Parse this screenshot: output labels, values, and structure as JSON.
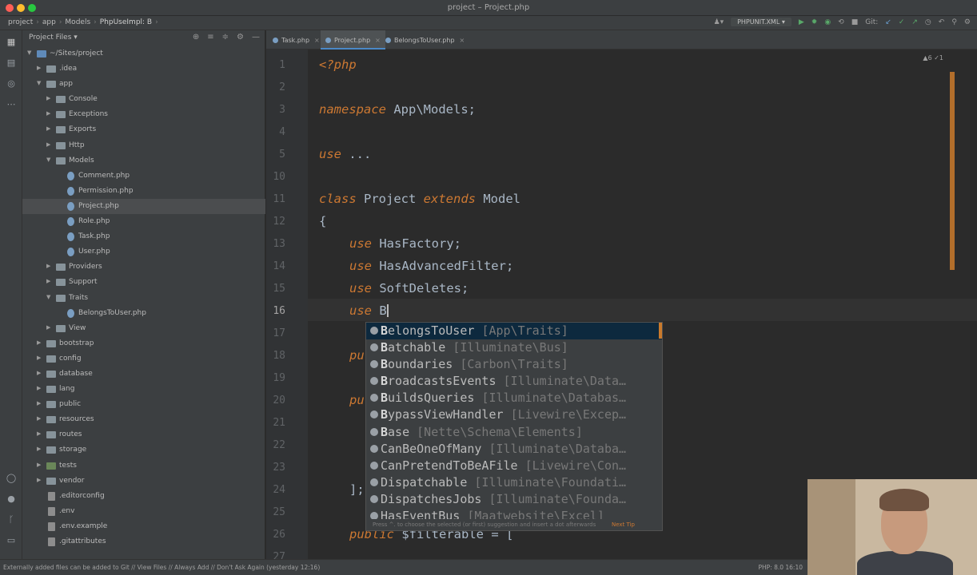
{
  "window": {
    "title": "project – Project.php"
  },
  "breadcrumb": [
    "project",
    "app",
    "Models",
    "PhpUseImpl: B"
  ],
  "toolbar": {
    "run_config": "PHPUNIT.XML",
    "git_label": "Git:"
  },
  "project_panel": {
    "title": "Project Files",
    "tree": [
      {
        "label": "~/Sites/project",
        "level": 0,
        "type": "folder",
        "open": true
      },
      {
        "label": ".idea",
        "level": 1,
        "type": "folder"
      },
      {
        "label": "app",
        "level": 1,
        "type": "folder",
        "open": true
      },
      {
        "label": "Console",
        "level": 2,
        "type": "folder"
      },
      {
        "label": "Exceptions",
        "level": 2,
        "type": "folder"
      },
      {
        "label": "Exports",
        "level": 2,
        "type": "folder"
      },
      {
        "label": "Http",
        "level": 2,
        "type": "folder"
      },
      {
        "label": "Models",
        "level": 2,
        "type": "folder",
        "open": true
      },
      {
        "label": "Comment.php",
        "level": 3,
        "type": "php"
      },
      {
        "label": "Permission.php",
        "level": 3,
        "type": "php"
      },
      {
        "label": "Project.php",
        "level": 3,
        "type": "php",
        "selected": true
      },
      {
        "label": "Role.php",
        "level": 3,
        "type": "php"
      },
      {
        "label": "Task.php",
        "level": 3,
        "type": "php"
      },
      {
        "label": "User.php",
        "level": 3,
        "type": "php"
      },
      {
        "label": "Providers",
        "level": 2,
        "type": "folder"
      },
      {
        "label": "Support",
        "level": 2,
        "type": "folder"
      },
      {
        "label": "Traits",
        "level": 2,
        "type": "folder",
        "open": true
      },
      {
        "label": "BelongsToUser.php",
        "level": 3,
        "type": "php"
      },
      {
        "label": "View",
        "level": 2,
        "type": "folder"
      },
      {
        "label": "bootstrap",
        "level": 1,
        "type": "folder"
      },
      {
        "label": "config",
        "level": 1,
        "type": "folder"
      },
      {
        "label": "database",
        "level": 1,
        "type": "folder"
      },
      {
        "label": "lang",
        "level": 1,
        "type": "folder"
      },
      {
        "label": "public",
        "level": 1,
        "type": "folder"
      },
      {
        "label": "resources",
        "level": 1,
        "type": "folder"
      },
      {
        "label": "routes",
        "level": 1,
        "type": "folder"
      },
      {
        "label": "storage",
        "level": 1,
        "type": "folder"
      },
      {
        "label": "tests",
        "level": 1,
        "type": "folder",
        "green": true
      },
      {
        "label": "vendor",
        "level": 1,
        "type": "folder"
      },
      {
        "label": ".editorconfig",
        "level": 1,
        "type": "file"
      },
      {
        "label": ".env",
        "level": 1,
        "type": "file"
      },
      {
        "label": ".env.example",
        "level": 1,
        "type": "file"
      },
      {
        "label": ".gitattributes",
        "level": 1,
        "type": "file"
      }
    ]
  },
  "tabs": [
    {
      "label": "Task.php",
      "active": false
    },
    {
      "label": "Project.php",
      "active": true
    },
    {
      "label": "BelongsToUser.php",
      "active": false
    }
  ],
  "editor": {
    "inspection": "▲6 ✓1",
    "line_numbers": [
      "1",
      "2",
      "3",
      "4",
      "5",
      "10",
      "11",
      "12",
      "13",
      "14",
      "15",
      "16",
      "17",
      "18",
      "19",
      "20",
      "21",
      "22",
      "23",
      "24",
      "25",
      "26",
      "27"
    ],
    "current_line": "16",
    "code": {
      "l1": "<?php",
      "l3_kw": "namespace",
      "l3_rest": " App\\Models;",
      "l5_kw": "use",
      "l5_rest": " ...",
      "l11_kw1": "class",
      "l11_mid": " Project ",
      "l11_kw2": "extends",
      "l11_rest": " Model",
      "l12": "{",
      "l13_kw": "use",
      "l13_rest": " HasFactory;",
      "l14_kw": "use",
      "l14_rest": " HasAdvancedFilter;",
      "l15_kw": "use",
      "l15_rest": " SoftDeletes;",
      "l16_kw": "use",
      "l16_rest": " B",
      "l18_kw": "pu",
      "l20_kw": "pu",
      "l24": "];",
      "l26_kw": "public",
      "l26_rest": " $filterable = ["
    }
  },
  "autocomplete": {
    "items": [
      {
        "pre": "B",
        "name": "elongsToUser",
        "ns": "[App\\Traits]",
        "selected": true
      },
      {
        "pre": "B",
        "name": "atchable",
        "ns": "[Illuminate\\Bus]"
      },
      {
        "pre": "B",
        "name": "oundaries",
        "ns": "[Carbon\\Traits]"
      },
      {
        "pre": "B",
        "name": "roadcastsEvents",
        "ns": "[Illuminate\\Data…"
      },
      {
        "pre": "B",
        "name": "uildsQueries",
        "ns": "[Illuminate\\Databas…"
      },
      {
        "pre": "B",
        "name": "ypassViewHandler",
        "ns": "[Livewire\\Excep…"
      },
      {
        "pre": "B",
        "name": "ase",
        "ns": "[Nette\\Schema\\Elements]"
      },
      {
        "pre": "",
        "name": "CanBeOneOfMany",
        "ns": "[Illuminate\\Databa…"
      },
      {
        "pre": "",
        "name": "CanPretendToBeAFile",
        "ns": "[Livewire\\Con…"
      },
      {
        "pre": "",
        "name": "Dispatchable",
        "ns": "[Illuminate\\Foundati…"
      },
      {
        "pre": "",
        "name": "DispatchesJobs",
        "ns": "[Illuminate\\Founda…"
      },
      {
        "pre": "",
        "name": "HasEventBus",
        "ns": "[Maatwebsite\\Excel]"
      }
    ],
    "footer": "Press ^. to choose the selected (or first) suggestion and insert a dot afterwards",
    "tip": "Next Tip"
  },
  "status": {
    "message": "Externally added files can be added to Git // View Files // Always Add // Don't Ask Again (yesterday 12:16)",
    "right": "PHP: 8.0   16:10"
  }
}
